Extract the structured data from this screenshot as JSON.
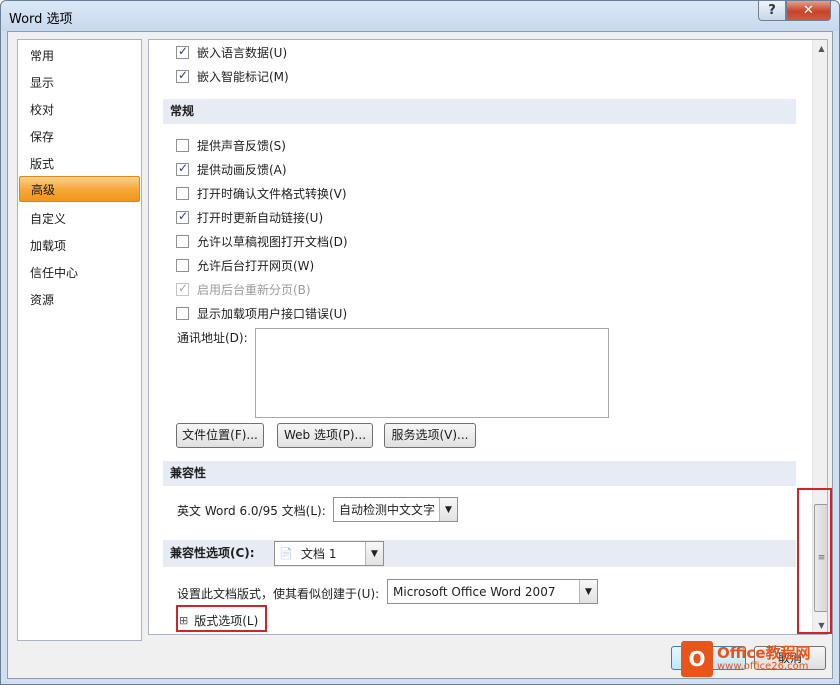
{
  "window": {
    "title": "Word 选项",
    "help_label": "?",
    "close_label": "✕"
  },
  "nav": {
    "items": [
      {
        "label": "常用"
      },
      {
        "label": "显示"
      },
      {
        "label": "校对"
      },
      {
        "label": "保存"
      },
      {
        "label": "版式"
      },
      {
        "label": "高级",
        "active": true
      },
      {
        "label": "自定义"
      },
      {
        "label": "加载项"
      },
      {
        "label": "信任中心"
      },
      {
        "label": "资源"
      }
    ]
  },
  "content": {
    "top_checks": [
      {
        "label": "嵌入语言数据(U)",
        "checked": true
      },
      {
        "label": "嵌入智能标记(M)",
        "checked": true
      }
    ],
    "general": {
      "heading": "常规",
      "checks": [
        {
          "label": "提供声音反馈(S)",
          "checked": false
        },
        {
          "label": "提供动画反馈(A)",
          "checked": true
        },
        {
          "label": "打开时确认文件格式转换(V)",
          "checked": false
        },
        {
          "label": "打开时更新自动链接(U)",
          "checked": true
        },
        {
          "label": "允许以草稿视图打开文档(D)",
          "checked": false
        },
        {
          "label": "允许后台打开网页(W)",
          "checked": false
        },
        {
          "label": "启用后台重新分页(B)",
          "checked": true,
          "disabled": true
        },
        {
          "label": "显示加载项用户接口错误(U)",
          "checked": false
        }
      ],
      "address_label": "通讯地址(D):",
      "buttons": {
        "file_locations": "文件位置(F)...",
        "web_options": "Web 选项(P)...",
        "service_options": "服务选项(V)..."
      }
    },
    "compat": {
      "heading": "兼容性",
      "word95_label": "英文 Word 6.0/95 文档(L):",
      "word95_value": "自动检测中文文字"
    },
    "compat_options": {
      "heading": "兼容性选项(C):",
      "doc_value": "文档 1",
      "layout_label": "设置此文档版式，使其看似创建于(U):",
      "layout_value": "Microsoft Office Word 2007",
      "layout_options_label": "版式选项(L)",
      "expand_glyph": "⊞"
    }
  },
  "footer": {
    "cancel_label": "取消"
  },
  "watermark": {
    "brand": "Office教程网",
    "url": "www.office26.com",
    "mark": "O"
  },
  "icons": {
    "scroll_up": "▲",
    "scroll_down": "▼",
    "dropdown": "▼",
    "thumb_grip": "≡",
    "doc": "📄"
  }
}
